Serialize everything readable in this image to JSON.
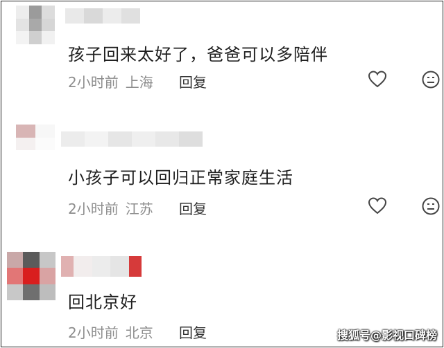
{
  "comments": [
    {
      "text": "孩子回来太好了，爸爸可以多陪伴",
      "time": "2小时前",
      "location": "上海",
      "reply_label": "回复",
      "like_icon": "heart-outline-icon",
      "dislike_icon": "neutral-face-icon"
    },
    {
      "text": "小孩子可以回归正常家庭生活",
      "time": "2小时前",
      "location": "江苏",
      "reply_label": "回复",
      "like_icon": "heart-outline-icon",
      "dislike_icon": "neutral-face-icon"
    },
    {
      "text": "回北京好",
      "time": "2小时前",
      "location": "北京",
      "reply_label": "回复"
    }
  ],
  "watermark": "搜狐号@影视口碑榜",
  "colors": {
    "text": "#1f1f1f",
    "meta": "#8d8d8d",
    "reply": "#333333",
    "icon": "#444444",
    "border": "#1c1c1c"
  }
}
